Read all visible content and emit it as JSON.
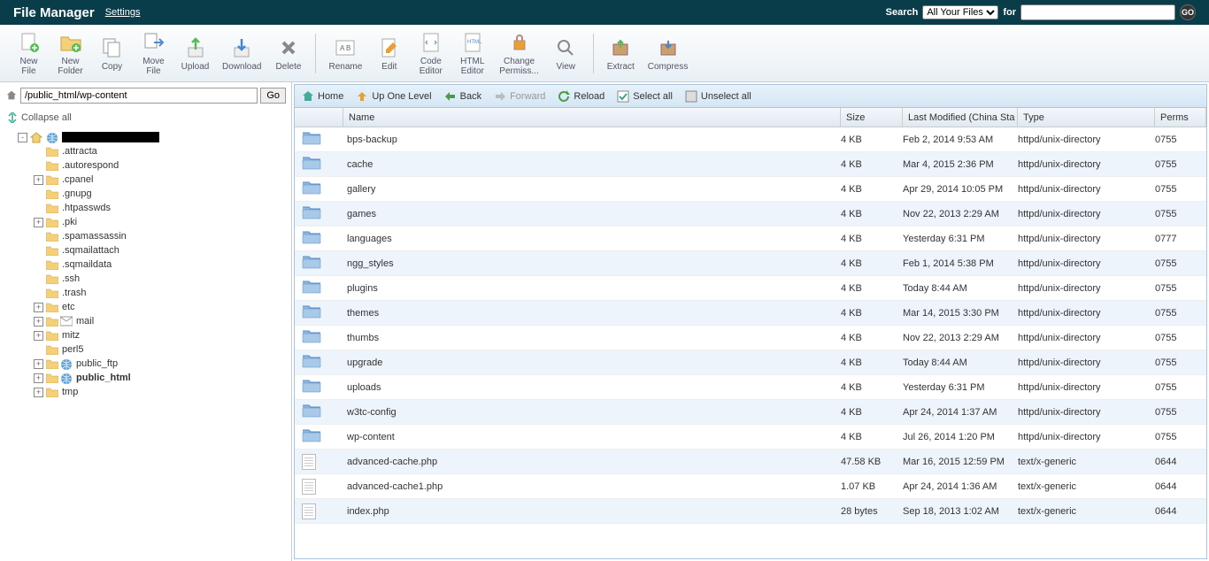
{
  "header": {
    "title": "File Manager",
    "settings": "Settings",
    "search_label": "Search",
    "search_select": "All Your Files",
    "for_label": "for",
    "go": "GO"
  },
  "toolbar": [
    {
      "label": "New File",
      "icon": "new-file"
    },
    {
      "label": "New Folder",
      "icon": "new-folder"
    },
    {
      "label": "Copy",
      "icon": "copy"
    },
    {
      "label": "Move File",
      "icon": "move"
    },
    {
      "label": "Upload",
      "icon": "upload"
    },
    {
      "label": "Download",
      "icon": "download"
    },
    {
      "label": "Delete",
      "icon": "delete"
    },
    {
      "sep": true
    },
    {
      "label": "Rename",
      "icon": "rename"
    },
    {
      "label": "Edit",
      "icon": "edit"
    },
    {
      "label": "Code Editor",
      "icon": "code"
    },
    {
      "label": "HTML Editor",
      "icon": "html"
    },
    {
      "label": "Change Permiss...",
      "icon": "perms"
    },
    {
      "label": "View",
      "icon": "view"
    },
    {
      "sep": true
    },
    {
      "label": "Extract",
      "icon": "extract"
    },
    {
      "label": "Compress",
      "icon": "compress"
    }
  ],
  "path": "/public_html/wp-content",
  "path_go": "Go",
  "collapse_all": "Collapse all",
  "tree": [
    {
      "label": "",
      "redacted": true,
      "indent": 1,
      "expander": "-",
      "icons": [
        "home",
        "globe"
      ]
    },
    {
      "label": ".attracta",
      "indent": 2
    },
    {
      "label": ".autorespond",
      "indent": 2
    },
    {
      "label": ".cpanel",
      "indent": 2,
      "expander": "+"
    },
    {
      "label": ".gnupg",
      "indent": 2
    },
    {
      "label": ".htpasswds",
      "indent": 2
    },
    {
      "label": ".pki",
      "indent": 2,
      "expander": "+"
    },
    {
      "label": ".spamassassin",
      "indent": 2
    },
    {
      "label": ".sqmailattach",
      "indent": 2
    },
    {
      "label": ".sqmaildata",
      "indent": 2
    },
    {
      "label": ".ssh",
      "indent": 2
    },
    {
      "label": ".trash",
      "indent": 2
    },
    {
      "label": "etc",
      "indent": 2,
      "expander": "+"
    },
    {
      "label": "mail",
      "indent": 2,
      "expander": "+",
      "mail": true
    },
    {
      "label": "mitz",
      "indent": 2,
      "expander": "+"
    },
    {
      "label": "perl5",
      "indent": 2
    },
    {
      "label": "public_ftp",
      "indent": 2,
      "expander": "+",
      "globe": true
    },
    {
      "label": "public_html",
      "indent": 2,
      "expander": "+",
      "globe": true,
      "bold": true
    },
    {
      "label": "tmp",
      "indent": 2,
      "expander": "+"
    }
  ],
  "nav": {
    "home": "Home",
    "up": "Up One Level",
    "back": "Back",
    "forward": "Forward",
    "reload": "Reload",
    "select_all": "Select all",
    "unselect_all": "Unselect all"
  },
  "columns": {
    "name": "Name",
    "size": "Size",
    "modified": "Last Modified (China Sta",
    "type": "Type",
    "perms": "Perms"
  },
  "files": [
    {
      "name": "bps-backup",
      "size": "4 KB",
      "mod": "Feb 2, 2014 9:53 AM",
      "type": "httpd/unix-directory",
      "perms": "0755",
      "dir": true
    },
    {
      "name": "cache",
      "size": "4 KB",
      "mod": "Mar 4, 2015 2:36 PM",
      "type": "httpd/unix-directory",
      "perms": "0755",
      "dir": true
    },
    {
      "name": "gallery",
      "size": "4 KB",
      "mod": "Apr 29, 2014 10:05 PM",
      "type": "httpd/unix-directory",
      "perms": "0755",
      "dir": true
    },
    {
      "name": "games",
      "size": "4 KB",
      "mod": "Nov 22, 2013 2:29 AM",
      "type": "httpd/unix-directory",
      "perms": "0755",
      "dir": true
    },
    {
      "name": "languages",
      "size": "4 KB",
      "mod": "Yesterday 6:31 PM",
      "type": "httpd/unix-directory",
      "perms": "0777",
      "dir": true
    },
    {
      "name": "ngg_styles",
      "size": "4 KB",
      "mod": "Feb 1, 2014 5:38 PM",
      "type": "httpd/unix-directory",
      "perms": "0755",
      "dir": true
    },
    {
      "name": "plugins",
      "size": "4 KB",
      "mod": "Today 8:44 AM",
      "type": "httpd/unix-directory",
      "perms": "0755",
      "dir": true
    },
    {
      "name": "themes",
      "size": "4 KB",
      "mod": "Mar 14, 2015 3:30 PM",
      "type": "httpd/unix-directory",
      "perms": "0755",
      "dir": true
    },
    {
      "name": "thumbs",
      "size": "4 KB",
      "mod": "Nov 22, 2013 2:29 AM",
      "type": "httpd/unix-directory",
      "perms": "0755",
      "dir": true
    },
    {
      "name": "upgrade",
      "size": "4 KB",
      "mod": "Today 8:44 AM",
      "type": "httpd/unix-directory",
      "perms": "0755",
      "dir": true
    },
    {
      "name": "uploads",
      "size": "4 KB",
      "mod": "Yesterday 6:31 PM",
      "type": "httpd/unix-directory",
      "perms": "0755",
      "dir": true
    },
    {
      "name": "w3tc-config",
      "size": "4 KB",
      "mod": "Apr 24, 2014 1:37 AM",
      "type": "httpd/unix-directory",
      "perms": "0755",
      "dir": true
    },
    {
      "name": "wp-content",
      "size": "4 KB",
      "mod": "Jul 26, 2014 1:20 PM",
      "type": "httpd/unix-directory",
      "perms": "0755",
      "dir": true
    },
    {
      "name": "advanced-cache.php",
      "size": "47.58 KB",
      "mod": "Mar 16, 2015 12:59 PM",
      "type": "text/x-generic",
      "perms": "0644",
      "dir": false
    },
    {
      "name": "advanced-cache1.php",
      "size": "1.07 KB",
      "mod": "Apr 24, 2014 1:36 AM",
      "type": "text/x-generic",
      "perms": "0644",
      "dir": false
    },
    {
      "name": "index.php",
      "size": "28 bytes",
      "mod": "Sep 18, 2013 1:02 AM",
      "type": "text/x-generic",
      "perms": "0644",
      "dir": false
    }
  ]
}
